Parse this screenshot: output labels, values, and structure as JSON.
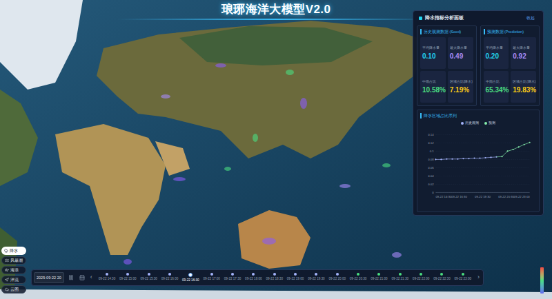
{
  "title": "琅琊海洋大模型V2.0",
  "panel": {
    "title": "降水指标分析面板",
    "collapse": "收起",
    "sections": [
      {
        "title": "历史观测数据 (Seed)",
        "metrics": [
          {
            "label": "平均降水量",
            "value": "0.10",
            "color": "#22d3ee"
          },
          {
            "label": "最大降水量",
            "value": "0.49",
            "color": "#a78bfa"
          },
          {
            "label": "中雨占比",
            "value": "10.58%",
            "color": "#4ade80"
          },
          {
            "label": "区域占比(降水)",
            "value": "7.19%",
            "color": "#facc15"
          }
        ]
      },
      {
        "title": "预测数据 (Prediction)",
        "metrics": [
          {
            "label": "平均降水量",
            "value": "0.20",
            "color": "#22d3ee"
          },
          {
            "label": "最大降水量",
            "value": "0.92",
            "color": "#a78bfa"
          },
          {
            "label": "中雨占比",
            "value": "65.34%",
            "color": "#4ade80"
          },
          {
            "label": "区域占比(降水)",
            "value": "19.83%",
            "color": "#facc15"
          }
        ]
      }
    ],
    "chart": {
      "title": "降水区域占比序列",
      "y_ticks": [
        "0",
        "0.02",
        "0.04",
        "0.06",
        "0.08",
        "0.1",
        "0.12",
        "0.14"
      ],
      "x_ticks": [
        "09-22 14:30",
        "09-22 16:30",
        "09-22 18:30",
        "09-22 20:30",
        "09-22 23:00"
      ],
      "series": [
        {
          "name": "历史观测",
          "color": "#a5b4fc",
          "values": [
            0.08,
            0.08,
            0.081,
            0.081,
            0.081,
            0.082,
            0.082,
            0.083,
            0.083,
            0.084,
            0.085,
            0.086
          ]
        },
        {
          "name": "预测",
          "color": "#86efac",
          "values": [
            0.087,
            0.1,
            0.104,
            0.11,
            0.116,
            0.121
          ]
        }
      ]
    }
  },
  "layers": [
    {
      "label": "降水",
      "selected": true
    },
    {
      "label": "风暴潮",
      "selected": false
    },
    {
      "label": "海浪",
      "selected": false
    },
    {
      "label": "洋流",
      "selected": false
    },
    {
      "label": "云图",
      "selected": false
    }
  ],
  "timeline": {
    "date": "2025-09-22 20",
    "prev": "‹",
    "next": "›",
    "times": [
      {
        "label": "09-22 14:30",
        "kind": "history",
        "selected": false
      },
      {
        "label": "09-22 15:00",
        "kind": "history",
        "selected": false
      },
      {
        "label": "09-22 15:30",
        "kind": "history",
        "selected": false
      },
      {
        "label": "09-22 16:00",
        "kind": "history",
        "selected": false
      },
      {
        "label": "09-22 16:30",
        "kind": "history",
        "selected": true
      },
      {
        "label": "09-22 17:00",
        "kind": "history",
        "selected": false
      },
      {
        "label": "09-22 17:30",
        "kind": "history",
        "selected": false
      },
      {
        "label": "09-22 18:00",
        "kind": "history",
        "selected": false
      },
      {
        "label": "09-22 18:30",
        "kind": "history",
        "selected": false
      },
      {
        "label": "09-22 19:00",
        "kind": "history",
        "selected": false
      },
      {
        "label": "09-22 19:30",
        "kind": "history",
        "selected": false
      },
      {
        "label": "09-22 20:00",
        "kind": "history",
        "selected": false
      },
      {
        "label": "09-22 20:30",
        "kind": "prediction",
        "selected": false
      },
      {
        "label": "09-22 21:00",
        "kind": "prediction",
        "selected": false
      },
      {
        "label": "09-22 21:30",
        "kind": "prediction",
        "selected": false
      },
      {
        "label": "09-22 22:00",
        "kind": "prediction",
        "selected": false
      },
      {
        "label": "09-22 22:30",
        "kind": "prediction",
        "selected": false
      },
      {
        "label": "09-22 23:00",
        "kind": "prediction",
        "selected": false
      }
    ]
  }
}
